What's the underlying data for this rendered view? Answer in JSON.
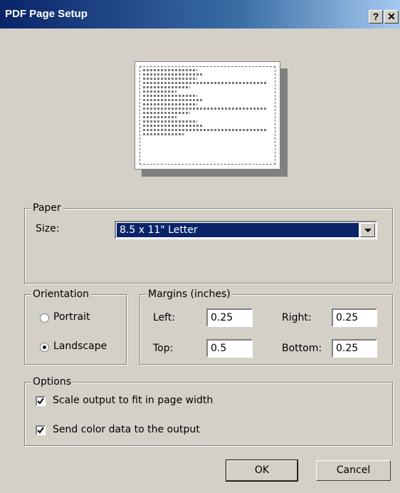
{
  "window": {
    "title": "PDF Page Setup",
    "help_glyph": "?",
    "close_glyph": "✕"
  },
  "paper": {
    "group_label": "Paper",
    "size_label": "Size:",
    "size_value": "8.5 x 11\" Letter"
  },
  "orientation": {
    "group_label": "Orientation",
    "portrait_label": "Portrait",
    "landscape_label": "Landscape",
    "selected": "landscape"
  },
  "margins": {
    "group_label": "Margins (inches)",
    "left_label": "Left:",
    "left_value": "0.25",
    "right_label": "Right:",
    "right_value": "0.25",
    "top_label": "Top:",
    "top_value": "0.5",
    "bottom_label": "Bottom:",
    "bottom_value": "0.25"
  },
  "options": {
    "group_label": "Options",
    "scale_label": "Scale output to fit in page width",
    "scale_checked": true,
    "color_label": "Send color data to the output",
    "color_checked": true
  },
  "buttons": {
    "ok": "OK",
    "cancel": "Cancel"
  }
}
